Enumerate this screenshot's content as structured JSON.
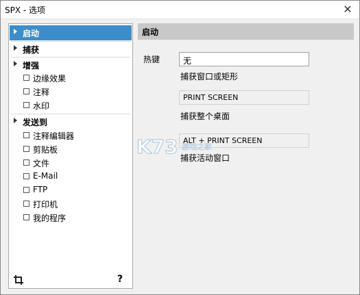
{
  "window": {
    "title": "SPX - 选项",
    "close_glyph": "✕"
  },
  "nav": {
    "groups": [
      {
        "label": "启动",
        "selected": true
      },
      {
        "label": "捕获",
        "selected": false
      },
      {
        "label": "增强",
        "selected": false
      },
      {
        "label": "发送到",
        "selected": false
      }
    ],
    "enhance_items": [
      "边缘效果",
      "注释",
      "水印"
    ],
    "send_items": [
      "注释编辑器",
      "剪贴板",
      "文件",
      "E-Mail",
      "FTP",
      "打印机",
      "我的程序"
    ],
    "footer": {
      "crop_icon": "crop-icon",
      "help_label": "?"
    }
  },
  "content": {
    "header": "启动",
    "hotkey_label": "热键",
    "hotkey_value": "无",
    "caption_1": "捕获窗口或矩形",
    "field_2": "PRINT SCREEN",
    "caption_2": "捕获整个桌面",
    "field_3": "ALT + PRINT SCREEN",
    "caption_3": "捕获活动窗口"
  },
  "watermark": {
    "text": "K73",
    "subtext": "游戏之家"
  },
  "colors": {
    "selected": "#3c8dc9",
    "header_bg": "#c8c8c8",
    "window_bg": "#f0f0f0"
  }
}
